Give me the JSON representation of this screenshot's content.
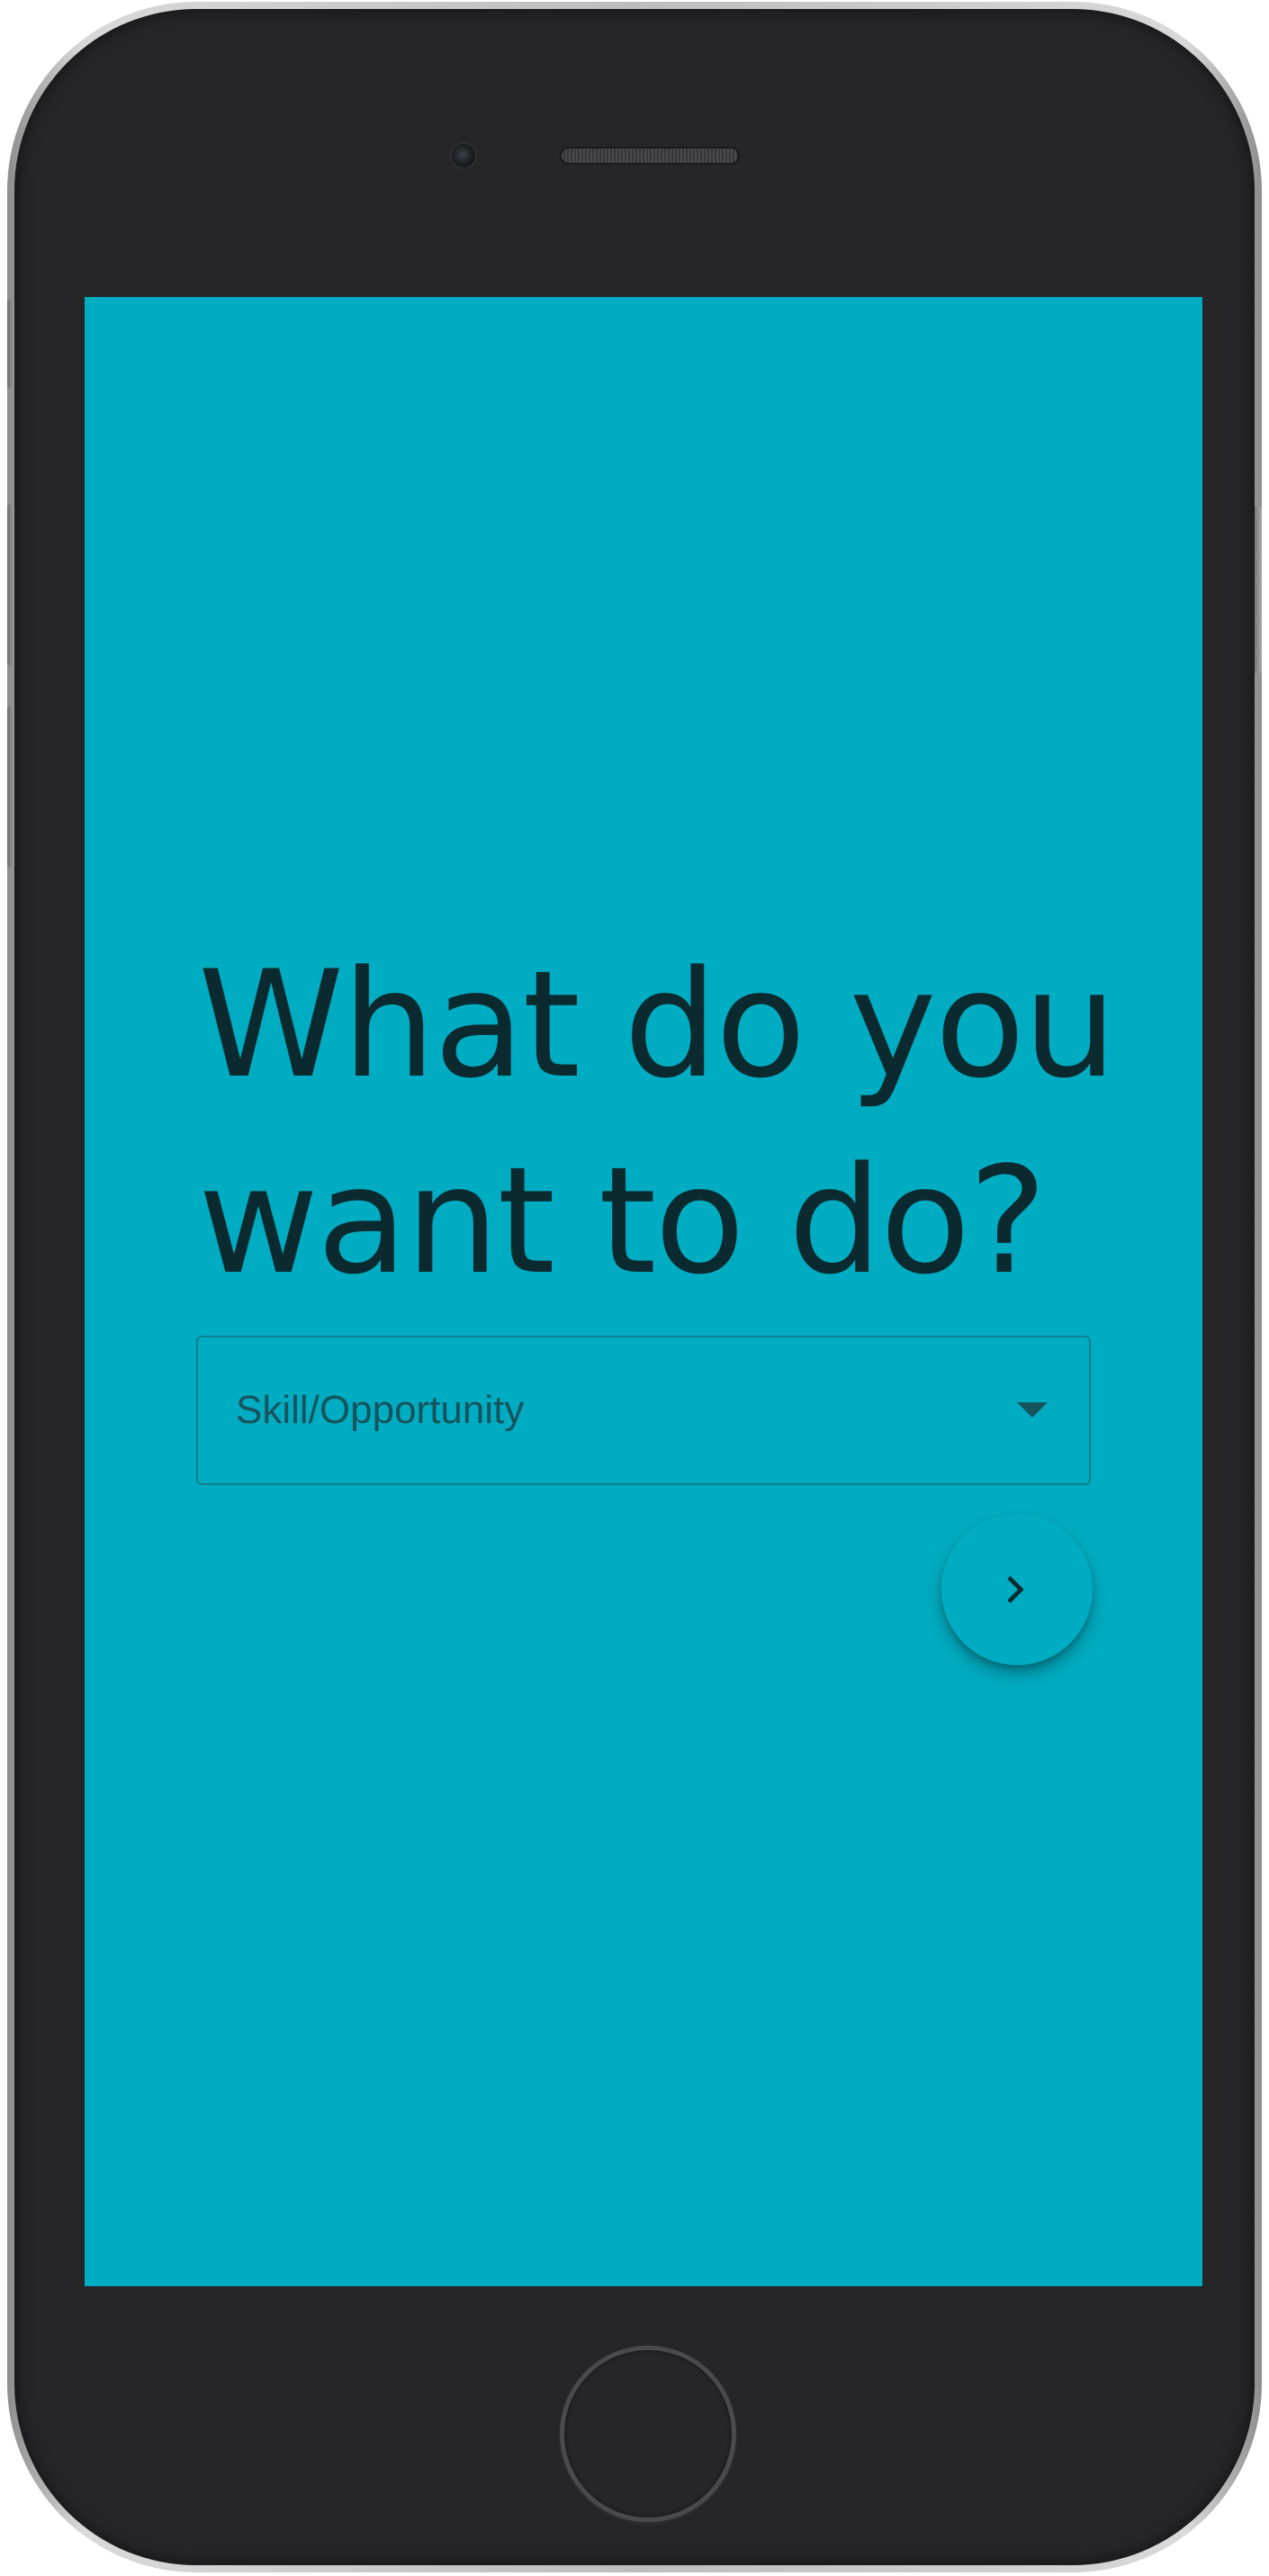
{
  "screen": {
    "background_color": "#00acc1",
    "title_line_1": "What do you",
    "title_line_2": "want to do?",
    "select": {
      "label": "Skill/Opportunity"
    },
    "next_button": {
      "icon": "chevron-right-icon"
    }
  },
  "device": {
    "type": "phone-frame",
    "home_button_icon": "home-button"
  }
}
